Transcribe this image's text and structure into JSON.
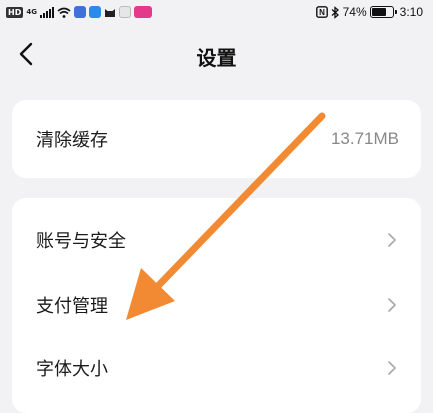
{
  "status_bar": {
    "hd_badge": "HD",
    "network": "4G",
    "battery_percent": "74%",
    "battery_level": 0.74,
    "time": "3:10"
  },
  "header": {
    "title": "设置"
  },
  "cache_card": {
    "label": "清除缓存",
    "value": "13.71MB"
  },
  "settings_list": {
    "items": [
      {
        "label": "账号与安全"
      },
      {
        "label": "支付管理"
      },
      {
        "label": "字体大小"
      }
    ]
  },
  "colors": {
    "background": "#f2f2f4",
    "card": "#ffffff",
    "arrow": "#f28a33",
    "secondary_text": "#888888"
  }
}
